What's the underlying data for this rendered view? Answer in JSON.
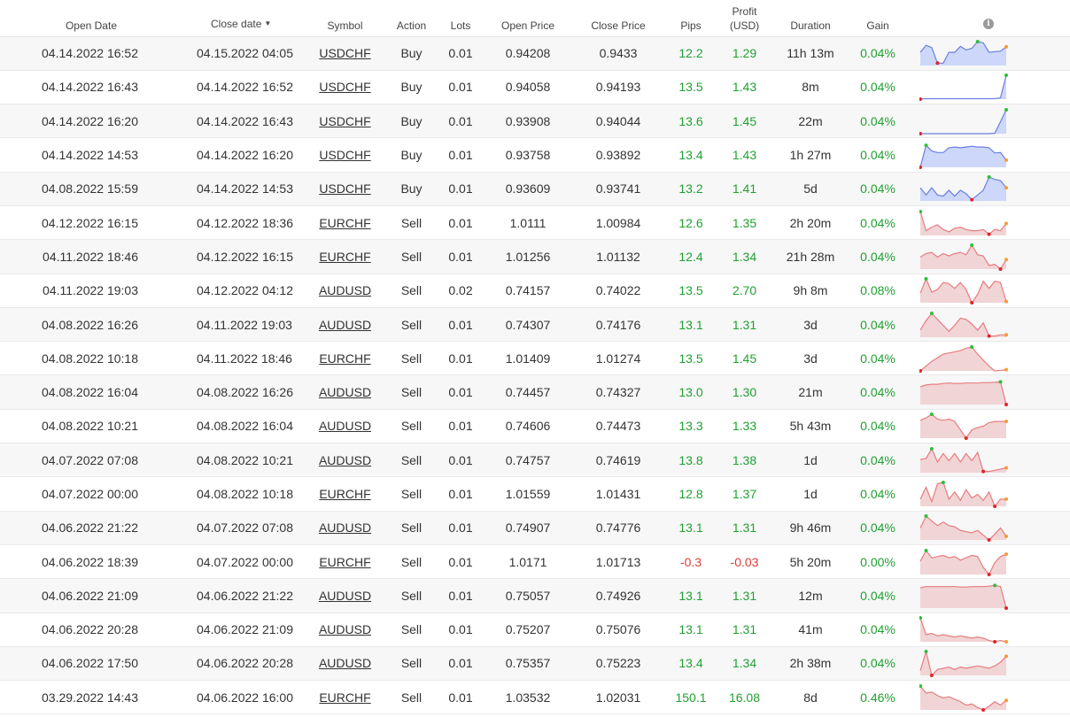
{
  "headers": {
    "open_date": "Open Date",
    "close_date": "Close date",
    "sort_arrow": "▼",
    "symbol": "Symbol",
    "action": "Action",
    "lots": "Lots",
    "open_price": "Open Price",
    "close_price": "Close Price",
    "pips": "Pips",
    "profit_line1": "Profit",
    "profit_line2": "(USD)",
    "duration": "Duration",
    "gain": "Gain",
    "info_icon": "i"
  },
  "colors": {
    "positive": "#20a032",
    "negative": "#e03a3a",
    "buy_line": "#6b7fe0",
    "buy_fill": "#cdd7fa",
    "sell_line": "#e87c80",
    "sell_fill": "#f1d4d6",
    "marker_high": "#2fbd3c",
    "marker_low": "#e0262a",
    "marker_last": "#f59a3a"
  },
  "trades": [
    {
      "open_date": "04.14.2022 16:52",
      "close_date": "04.15.2022 04:05",
      "symbol": "USDCHF",
      "action": "Buy",
      "lots": "0.01",
      "open_price": "0.94208",
      "close_price": "0.9433",
      "pips": "12.2",
      "profit": "1.29",
      "duration": "11h 13m",
      "gain": "0.04%",
      "spark": [
        0.55,
        0.85,
        0.75,
        0.1,
        0.1,
        0.55,
        0.55,
        0.8,
        0.65,
        0.72,
        1.0,
        0.95,
        0.55,
        0.58,
        0.6,
        0.78
      ],
      "spark_type": "buy"
    },
    {
      "open_date": "04.14.2022 16:43",
      "close_date": "04.14.2022 16:52",
      "symbol": "USDCHF",
      "action": "Buy",
      "lots": "0.01",
      "open_price": "0.94058",
      "close_price": "0.94193",
      "pips": "13.5",
      "profit": "1.43",
      "duration": "8m",
      "gain": "0.04%",
      "spark": [
        0.0,
        0.02,
        0.02,
        0.02,
        0.02,
        0.02,
        0.02,
        0.02,
        0.02,
        0.02,
        0.02,
        0.02,
        0.02,
        0.02,
        0.05,
        1.0
      ],
      "spark_type": "buy"
    },
    {
      "open_date": "04.14.2022 16:20",
      "close_date": "04.14.2022 16:43",
      "symbol": "USDCHF",
      "action": "Buy",
      "lots": "0.01",
      "open_price": "0.93908",
      "close_price": "0.94044",
      "pips": "13.6",
      "profit": "1.45",
      "duration": "22m",
      "gain": "0.04%",
      "spark": [
        0.0,
        0.0,
        0.0,
        0.0,
        0.0,
        0.0,
        0.0,
        0.0,
        0.0,
        0.0,
        0.0,
        0.0,
        0.0,
        0.02,
        0.5,
        1.0
      ],
      "spark_type": "buy"
    },
    {
      "open_date": "04.14.2022 14:53",
      "close_date": "04.14.2022 16:20",
      "symbol": "USDCHF",
      "action": "Buy",
      "lots": "0.01",
      "open_price": "0.93758",
      "close_price": "0.93892",
      "pips": "13.4",
      "profit": "1.43",
      "duration": "1h 27m",
      "gain": "0.04%",
      "spark": [
        0.0,
        0.92,
        0.68,
        0.62,
        0.62,
        0.82,
        0.85,
        0.82,
        0.85,
        0.88,
        0.85,
        0.85,
        0.82,
        0.6,
        0.62,
        0.3
      ],
      "spark_type": "buy"
    },
    {
      "open_date": "04.08.2022 15:59",
      "close_date": "04.14.2022 14:53",
      "symbol": "USDCHF",
      "action": "Buy",
      "lots": "0.01",
      "open_price": "0.93609",
      "close_price": "0.93741",
      "pips": "13.2",
      "profit": "1.41",
      "duration": "5d",
      "gain": "0.04%",
      "spark": [
        0.55,
        0.25,
        0.55,
        0.25,
        0.2,
        0.45,
        0.2,
        0.45,
        0.3,
        0.05,
        0.25,
        0.45,
        1.0,
        0.9,
        0.85,
        0.55
      ],
      "spark_type": "buy"
    },
    {
      "open_date": "04.12.2022 16:15",
      "close_date": "04.12.2022 18:36",
      "symbol": "EURCHF",
      "action": "Sell",
      "lots": "0.01",
      "open_price": "1.0111",
      "close_price": "1.00984",
      "pips": "12.6",
      "profit": "1.35",
      "duration": "2h 20m",
      "gain": "0.04%",
      "spark": [
        1.0,
        0.2,
        0.35,
        0.45,
        0.25,
        0.15,
        0.3,
        0.35,
        0.25,
        0.2,
        0.2,
        0.25,
        0.05,
        0.25,
        0.2,
        0.5
      ],
      "spark_type": "sell"
    },
    {
      "open_date": "04.11.2022 18:46",
      "close_date": "04.12.2022 16:15",
      "symbol": "EURCHF",
      "action": "Sell",
      "lots": "0.01",
      "open_price": "1.01256",
      "close_price": "1.01132",
      "pips": "12.4",
      "profit": "1.34",
      "duration": "21h 28m",
      "gain": "0.04%",
      "spark": [
        0.5,
        0.65,
        0.7,
        0.5,
        0.65,
        0.55,
        0.65,
        0.7,
        0.6,
        1.0,
        0.6,
        0.55,
        0.15,
        0.2,
        0.0,
        0.4
      ],
      "spark_type": "sell"
    },
    {
      "open_date": "04.11.2022 19:03",
      "close_date": "04.12.2022 04:12",
      "symbol": "AUDUSD",
      "action": "Sell",
      "lots": "0.02",
      "open_price": "0.74157",
      "close_price": "0.74022",
      "pips": "13.5",
      "profit": "2.70",
      "duration": "9h 8m",
      "gain": "0.08%",
      "spark": [
        0.4,
        1.0,
        0.45,
        0.55,
        0.85,
        0.8,
        0.6,
        0.85,
        0.55,
        0.0,
        0.35,
        0.9,
        0.6,
        0.9,
        0.85,
        0.05
      ],
      "spark_type": "sell"
    },
    {
      "open_date": "04.08.2022 16:26",
      "close_date": "04.11.2022 19:03",
      "symbol": "AUDUSD",
      "action": "Sell",
      "lots": "0.01",
      "open_price": "0.74307",
      "close_price": "0.74176",
      "pips": "13.1",
      "profit": "1.31",
      "duration": "3d",
      "gain": "0.04%",
      "spark": [
        0.3,
        0.7,
        1.0,
        0.75,
        0.5,
        0.25,
        0.5,
        0.8,
        0.75,
        0.55,
        0.3,
        0.6,
        0.05,
        0.05,
        0.1,
        0.1
      ],
      "spark_type": "sell"
    },
    {
      "open_date": "04.08.2022 10:18",
      "close_date": "04.11.2022 18:46",
      "symbol": "EURCHF",
      "action": "Sell",
      "lots": "0.01",
      "open_price": "1.01409",
      "close_price": "1.01274",
      "pips": "13.5",
      "profit": "1.45",
      "duration": "3d",
      "gain": "0.04%",
      "spark": [
        0.0,
        0.2,
        0.4,
        0.55,
        0.7,
        0.75,
        0.8,
        0.85,
        0.95,
        1.0,
        0.7,
        0.45,
        0.2,
        0.0,
        0.02,
        0.05
      ],
      "spark_type": "sell"
    },
    {
      "open_date": "04.08.2022 16:04",
      "close_date": "04.08.2022 16:26",
      "symbol": "AUDUSD",
      "action": "Sell",
      "lots": "0.01",
      "open_price": "0.74457",
      "close_price": "0.74327",
      "pips": "13.0",
      "profit": "1.30",
      "duration": "21m",
      "gain": "0.04%",
      "spark": [
        0.75,
        0.82,
        0.85,
        0.85,
        0.88,
        0.9,
        0.88,
        0.88,
        0.9,
        0.9,
        0.9,
        0.92,
        0.92,
        0.93,
        0.95,
        0.0
      ],
      "spark_type": "sell"
    },
    {
      "open_date": "04.08.2022 10:21",
      "close_date": "04.08.2022 16:04",
      "symbol": "AUDUSD",
      "action": "Sell",
      "lots": "0.01",
      "open_price": "0.74606",
      "close_price": "0.74473",
      "pips": "13.3",
      "profit": "1.33",
      "duration": "5h 43m",
      "gain": "0.04%",
      "spark": [
        0.75,
        0.85,
        1.0,
        0.8,
        0.75,
        0.8,
        0.7,
        0.35,
        0.0,
        0.35,
        0.45,
        0.5,
        0.65,
        0.7,
        0.7,
        0.7
      ],
      "spark_type": "sell"
    },
    {
      "open_date": "04.07.2022 07:08",
      "close_date": "04.08.2022 10:21",
      "symbol": "AUDUSD",
      "action": "Sell",
      "lots": "0.01",
      "open_price": "0.74757",
      "close_price": "0.74619",
      "pips": "13.8",
      "profit": "1.38",
      "duration": "1d",
      "gain": "0.04%",
      "spark": [
        0.55,
        0.6,
        1.0,
        0.45,
        0.8,
        0.5,
        0.8,
        0.45,
        0.8,
        0.5,
        0.85,
        0.05,
        0.05,
        0.1,
        0.15,
        0.2
      ],
      "spark_type": "sell"
    },
    {
      "open_date": "04.07.2022 00:00",
      "close_date": "04.08.2022 10:18",
      "symbol": "EURCHF",
      "action": "Sell",
      "lots": "0.01",
      "open_price": "1.01559",
      "close_price": "1.01431",
      "pips": "12.8",
      "profit": "1.37",
      "duration": "1d",
      "gain": "0.04%",
      "spark": [
        0.3,
        0.8,
        0.2,
        0.95,
        1.0,
        0.3,
        0.6,
        0.25,
        0.7,
        0.35,
        0.5,
        0.25,
        0.6,
        0.0,
        0.3,
        0.3
      ],
      "spark_type": "sell"
    },
    {
      "open_date": "04.06.2022 21:22",
      "close_date": "04.07.2022 07:08",
      "symbol": "AUDUSD",
      "action": "Sell",
      "lots": "0.01",
      "open_price": "0.74907",
      "close_price": "0.74776",
      "pips": "13.1",
      "profit": "1.31",
      "duration": "9h 46m",
      "gain": "0.04%",
      "spark": [
        0.5,
        1.0,
        0.8,
        0.6,
        0.75,
        0.6,
        0.55,
        0.4,
        0.35,
        0.3,
        0.4,
        0.2,
        0.0,
        0.25,
        0.5,
        0.15
      ],
      "spark_type": "sell"
    },
    {
      "open_date": "04.06.2022 18:39",
      "close_date": "04.07.2022 00:00",
      "symbol": "EURCHF",
      "action": "Sell",
      "lots": "0.01",
      "open_price": "1.0171",
      "close_price": "1.01713",
      "pips": "-0.3",
      "profit": "-0.03",
      "duration": "5h 20m",
      "gain": "0.00%",
      "spark": [
        0.55,
        1.0,
        0.7,
        0.75,
        0.8,
        0.7,
        0.75,
        0.6,
        0.7,
        0.8,
        0.75,
        0.3,
        0.0,
        0.5,
        0.75,
        0.85
      ],
      "spark_type": "sell"
    },
    {
      "open_date": "04.06.2022 21:09",
      "close_date": "04.06.2022 21:22",
      "symbol": "AUDUSD",
      "action": "Sell",
      "lots": "0.01",
      "open_price": "0.75057",
      "close_price": "0.74926",
      "pips": "13.1",
      "profit": "1.31",
      "duration": "12m",
      "gain": "0.04%",
      "spark": [
        0.85,
        0.9,
        0.9,
        0.9,
        0.9,
        0.9,
        0.9,
        0.88,
        0.88,
        0.9,
        0.9,
        0.9,
        0.92,
        0.95,
        0.9,
        0.0
      ],
      "spark_type": "sell"
    },
    {
      "open_date": "04.06.2022 20:28",
      "close_date": "04.06.2022 21:09",
      "symbol": "AUDUSD",
      "action": "Sell",
      "lots": "0.01",
      "open_price": "0.75207",
      "close_price": "0.75076",
      "pips": "13.1",
      "profit": "1.31",
      "duration": "41m",
      "gain": "0.04%",
      "spark": [
        1.0,
        0.3,
        0.35,
        0.25,
        0.3,
        0.25,
        0.2,
        0.25,
        0.2,
        0.15,
        0.2,
        0.15,
        0.05,
        0.0,
        0.05,
        0.0
      ],
      "spark_type": "sell"
    },
    {
      "open_date": "04.06.2022 17:50",
      "close_date": "04.06.2022 20:28",
      "symbol": "AUDUSD",
      "action": "Sell",
      "lots": "0.01",
      "open_price": "0.75357",
      "close_price": "0.75223",
      "pips": "13.4",
      "profit": "1.34",
      "duration": "2h 38m",
      "gain": "0.04%",
      "spark": [
        0.2,
        1.0,
        0.0,
        0.25,
        0.3,
        0.35,
        0.25,
        0.35,
        0.3,
        0.35,
        0.4,
        0.35,
        0.3,
        0.4,
        0.55,
        0.8
      ],
      "spark_type": "sell"
    },
    {
      "open_date": "03.29.2022 14:43",
      "close_date": "04.06.2022 16:00",
      "symbol": "EURCHF",
      "action": "Sell",
      "lots": "0.01",
      "open_price": "1.03532",
      "close_price": "1.02031",
      "pips": "150.1",
      "profit": "16.08",
      "duration": "8d",
      "gain": "0.46%",
      "spark": [
        1.0,
        0.7,
        0.75,
        0.6,
        0.5,
        0.55,
        0.45,
        0.35,
        0.2,
        0.25,
        0.1,
        0.0,
        0.15,
        0.35,
        0.2,
        0.4
      ],
      "spark_type": "sell"
    }
  ]
}
